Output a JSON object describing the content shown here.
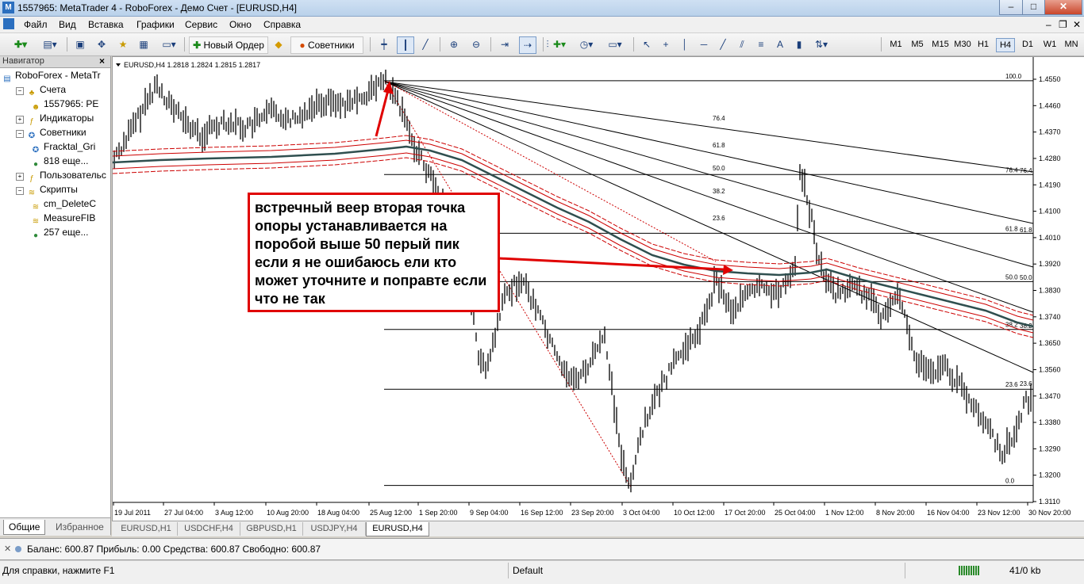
{
  "window": {
    "title": "1557965: MetaTrader 4 - RoboForex - Демо Счет - [EURUSD,H4]"
  },
  "menu": [
    "Файл",
    "Вид",
    "Вставка",
    "Графики",
    "Сервис",
    "Окно",
    "Справка"
  ],
  "toolbar": {
    "new_order": "Новый Ордер",
    "experts": "Советники",
    "timeframes": [
      "M1",
      "M5",
      "M15",
      "M30",
      "H1",
      "H4",
      "D1",
      "W1",
      "MN"
    ],
    "active_timeframe": "H4"
  },
  "navigator": {
    "title": "Навигатор",
    "close": "×",
    "items": [
      {
        "label": "RoboForex - MetaTr",
        "level": 0,
        "icon": "folder-icon"
      },
      {
        "label": "Счета",
        "level": 1,
        "icon": "accounts-icon"
      },
      {
        "label": "1557965: PE",
        "level": 2,
        "icon": "user-icon"
      },
      {
        "label": "Индикаторы",
        "level": 1,
        "icon": "indicator-icon"
      },
      {
        "label": "Советники",
        "level": 1,
        "icon": "expert-icon"
      },
      {
        "label": "Fracktal_Gri",
        "level": 2,
        "icon": "expert-icon"
      },
      {
        "label": "818 еще...",
        "level": 2,
        "icon": "globe-icon"
      },
      {
        "label": "Пользовательс",
        "level": 1,
        "icon": "indicator-icon"
      },
      {
        "label": "Скрипты",
        "level": 1,
        "icon": "script-icon"
      },
      {
        "label": "cm_DeleteC",
        "level": 2,
        "icon": "script-icon"
      },
      {
        "label": "MeasureFIB",
        "level": 2,
        "icon": "script-icon"
      },
      {
        "label": "257 еще...",
        "level": 2,
        "icon": "globe-icon"
      }
    ],
    "tabs": [
      "Общие",
      "Избранное"
    ],
    "active_tab": "Общие"
  },
  "chart": {
    "header": "EURUSD,H4  1.2818 1.2824 1.2815 1.2817",
    "price_ticks": [
      "1.4550",
      "1.4460",
      "1.4370",
      "1.4280",
      "1.4190",
      "1.4100",
      "1.4010",
      "1.3920",
      "1.3830",
      "1.3740",
      "1.3650",
      "1.3560",
      "1.3470",
      "1.3380",
      "1.3290",
      "1.3200",
      "1.3110"
    ],
    "time_ticks": [
      "19 Jul 2011",
      "27 Jul 04:00",
      "3 Aug 12:00",
      "10 Aug 20:00",
      "18 Aug 04:00",
      "25 Aug 12:00",
      "1 Sep 20:00",
      "9 Sep 04:00",
      "16 Sep 12:00",
      "23 Sep 20:00",
      "3 Oct 04:00",
      "10 Oct 12:00",
      "17 Oct 20:00",
      "25 Oct 04:00",
      "1 Nov 12:00",
      "8 Nov 20:00",
      "16 Nov 04:00",
      "23 Nov 12:00",
      "30 Nov 20:00"
    ],
    "fib_levels": [
      "100.0",
      "76.4",
      "61.8",
      "50.0",
      "38.2",
      "23.6",
      "0.0"
    ],
    "fan_labels": [
      "76.4",
      "61.8",
      "50.0",
      "38.2",
      "23.6"
    ],
    "fan_labels_right": [
      "76.4",
      "61.8",
      "50.0",
      "38.2",
      "23.6"
    ],
    "annotation": "встречный веер вторая точка опоры устанавливается на поробой выше 50 перый пик если я не ошибаюсь ели кто может уточните и поправте если что не так",
    "colors": {
      "annotation_border": "#e00000",
      "ma": "#2f4f4f",
      "band": "#cc0000"
    }
  },
  "chart_tabs": [
    "EURUSD,H1",
    "USDCHF,H4",
    "GBPUSD,H1",
    "USDJPY,H4",
    "EURUSD,H4"
  ],
  "active_chart_tab": "EURUSD,H4",
  "terminal": {
    "text": "Баланс: 600.87  Прибыль: 0.00  Средства: 600.87  Свободно: 600.87"
  },
  "status": {
    "help": "Для справки, нажмите F1",
    "profile": "Default",
    "traffic": "41/0 kb"
  }
}
